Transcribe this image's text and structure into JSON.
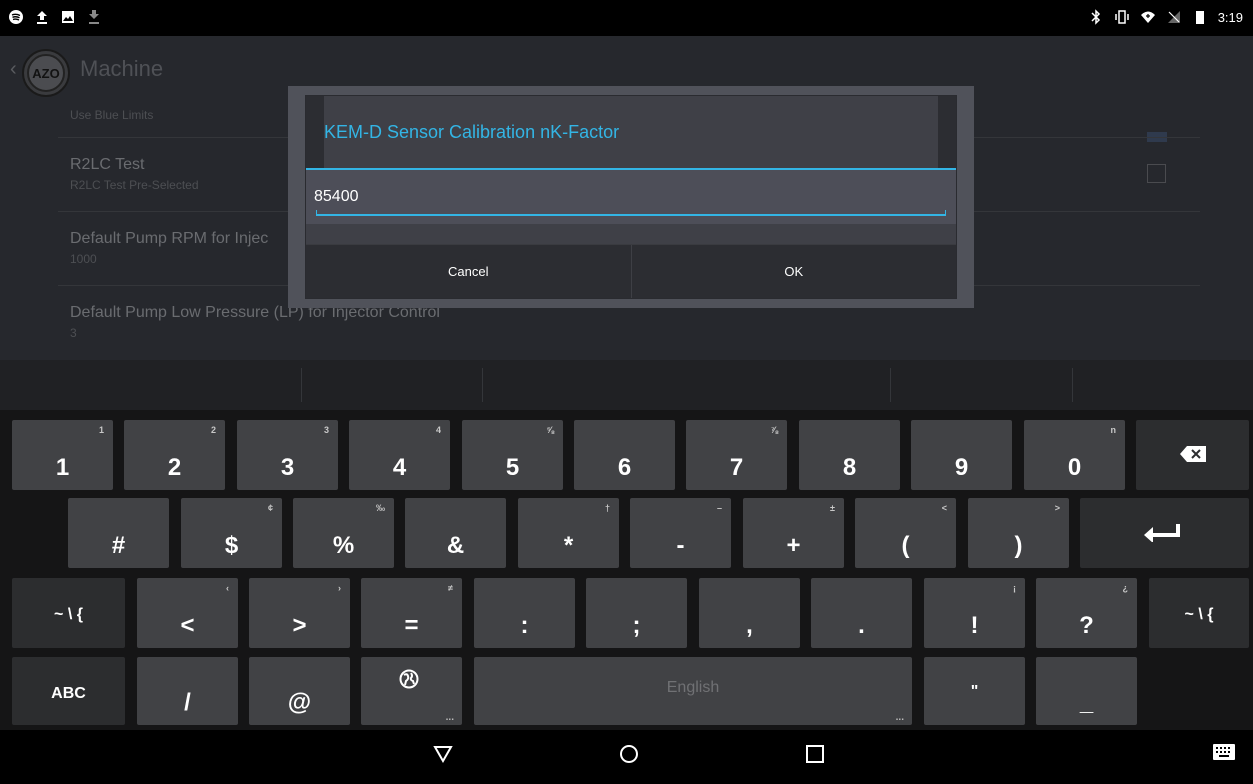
{
  "status_bar": {
    "left_icons": [
      "spotify-icon",
      "upload-icon",
      "image-icon",
      "download-icon"
    ],
    "right_icons": [
      "bluetooth-icon",
      "vibrate-icon",
      "wifi-icon",
      "no-sim-icon",
      "battery-icon"
    ],
    "time": "3:19"
  },
  "app": {
    "logo_text": "AZO",
    "title": "Machine",
    "prefs": [
      {
        "title": "",
        "summary": "Use Blue Limits"
      },
      {
        "title": "R2LC Test",
        "summary": "R2LC Test Pre-Selected"
      },
      {
        "title": "Default Pump RPM for Injec",
        "summary": "1000"
      },
      {
        "title": "Default Pump Low Pressure (LP) for Injector Control",
        "summary": "3"
      }
    ]
  },
  "dialog": {
    "title": "KEM-D Sensor Calibration nK-Factor",
    "input_value": "85400",
    "cancel_label": "Cancel",
    "ok_label": "OK"
  },
  "keyboard": {
    "row1": [
      {
        "main": "1",
        "hint": "1"
      },
      {
        "main": "2",
        "hint": "2"
      },
      {
        "main": "3",
        "hint": "3"
      },
      {
        "main": "4",
        "hint": "4"
      },
      {
        "main": "5",
        "hint": "⅝"
      },
      {
        "main": "6",
        "hint": ""
      },
      {
        "main": "7",
        "hint": "⅞"
      },
      {
        "main": "8",
        "hint": ""
      },
      {
        "main": "9",
        "hint": ""
      },
      {
        "main": "0",
        "hint": "n"
      }
    ],
    "row2": [
      {
        "main": "#",
        "hint": ""
      },
      {
        "main": "$",
        "hint": "¢"
      },
      {
        "main": "%",
        "hint": "‰"
      },
      {
        "main": "&",
        "hint": ""
      },
      {
        "main": "*",
        "hint": "†"
      },
      {
        "main": "-",
        "hint": "–"
      },
      {
        "main": "+",
        "hint": "±"
      },
      {
        "main": "(",
        "hint": "<"
      },
      {
        "main": ")",
        "hint": ">"
      }
    ],
    "row3": [
      {
        "main": "<",
        "hint": "‹"
      },
      {
        "main": ">",
        "hint": "›"
      },
      {
        "main": "=",
        "hint": "≠"
      },
      {
        "main": ":",
        "hint": ""
      },
      {
        "main": ";",
        "hint": ""
      },
      {
        "main": ",",
        "hint": ""
      },
      {
        "main": ".",
        "hint": ""
      },
      {
        "main": "!",
        "hint": "¡"
      },
      {
        "main": "?",
        "hint": "¿"
      }
    ],
    "more_symbols_label": "~ \\ {",
    "abc_label": "ABC",
    "slash_label": "/",
    "at_label": "@",
    "space_label": "English",
    "quote_label": "\"",
    "underscore_label": "_",
    "delete_icon": "backspace-icon",
    "enter_icon": "enter-icon",
    "globe_icon": "globe-icon"
  },
  "nav_bar": {
    "back_icon": "back-triangle-icon",
    "home_icon": "home-circle-icon",
    "recents_icon": "recents-square-icon",
    "keyboard_icon": "keyboard-icon"
  }
}
